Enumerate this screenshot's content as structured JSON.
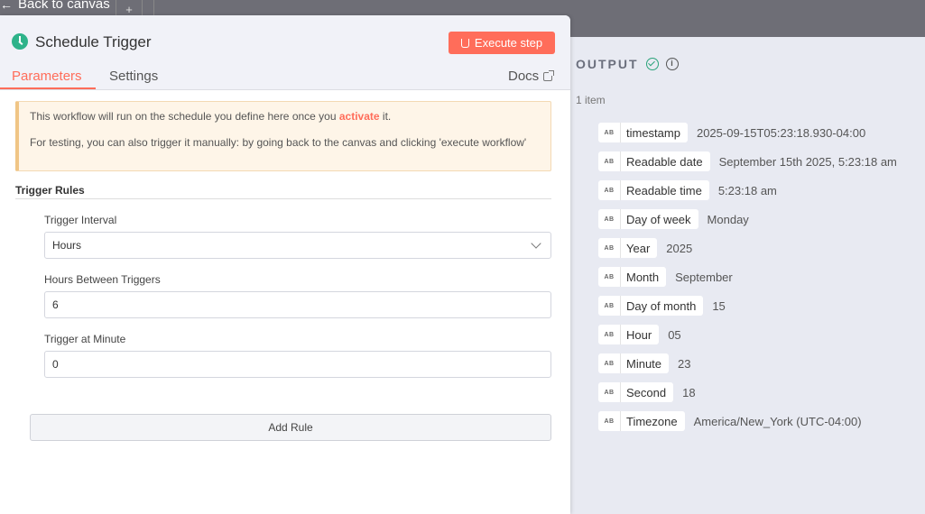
{
  "canvas": {
    "back_label": "Back to canvas",
    "tab_plus": "+"
  },
  "node": {
    "title": "Schedule Trigger",
    "execute_label": "Execute step",
    "tabs": [
      {
        "label": "Parameters",
        "active": true
      },
      {
        "label": "Settings",
        "active": false
      }
    ],
    "docs_label": "Docs"
  },
  "notice": {
    "line1_pre": "This workflow will run on the schedule you define here once you ",
    "line1_link": "activate",
    "line1_post": " it.",
    "line2": "For testing, you can also trigger it manually: by going back to the canvas and clicking 'execute workflow'"
  },
  "rules": {
    "section_title": "Trigger Rules",
    "interval_label": "Trigger Interval",
    "interval_value": "Hours",
    "hours_label": "Hours Between Triggers",
    "hours_value": "6",
    "minute_label": "Trigger at Minute",
    "minute_value": "0",
    "add_rule_label": "Add Rule"
  },
  "output": {
    "title": "OUTPUT",
    "item_count": "1 item",
    "type_badge": "AB",
    "fields": [
      {
        "key": "timestamp",
        "value": "2025-09-15T05:23:18.930-04:00"
      },
      {
        "key": "Readable date",
        "value": "September 15th 2025, 5:23:18 am"
      },
      {
        "key": "Readable time",
        "value": "5:23:18 am"
      },
      {
        "key": "Day of week",
        "value": "Monday"
      },
      {
        "key": "Year",
        "value": "2025"
      },
      {
        "key": "Month",
        "value": "September"
      },
      {
        "key": "Day of month",
        "value": "15"
      },
      {
        "key": "Hour",
        "value": "05"
      },
      {
        "key": "Minute",
        "value": "23"
      },
      {
        "key": "Second",
        "value": "18"
      },
      {
        "key": "Timezone",
        "value": "America/New_York (UTC-04:00)"
      }
    ]
  },
  "colors": {
    "accent": "#ff6d5a",
    "success": "#2eb38a",
    "warning_bg": "#fef5e8"
  }
}
